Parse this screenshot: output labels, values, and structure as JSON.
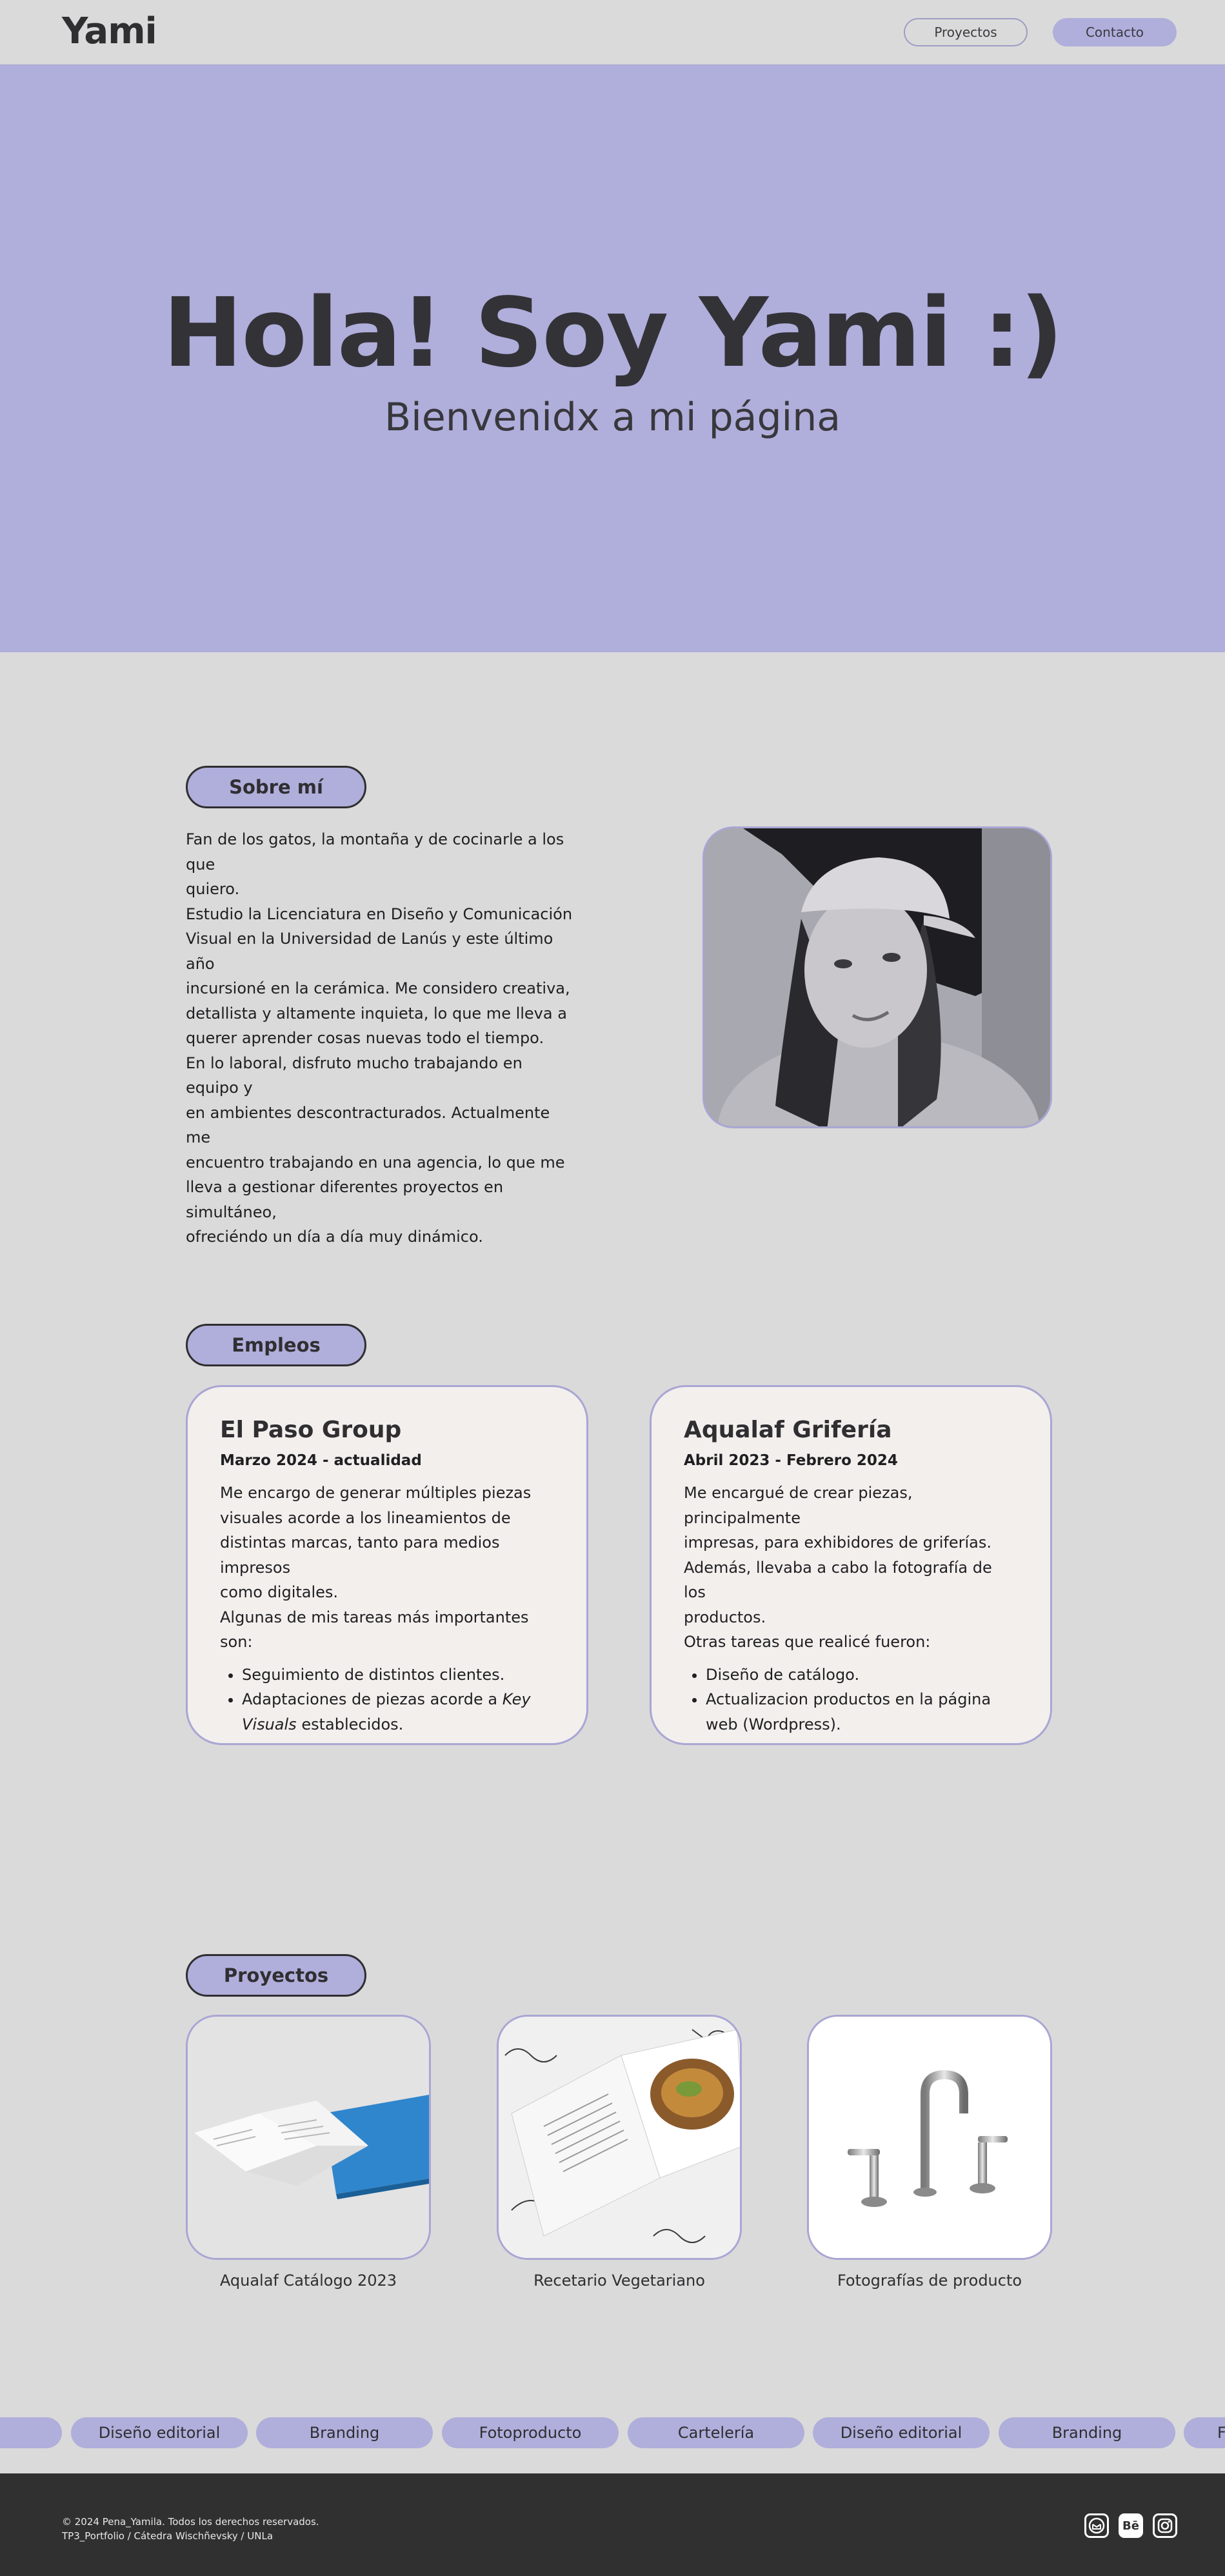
{
  "header": {
    "logo": "Yami",
    "nav": {
      "projects": "Proyectos",
      "contact": "Contacto"
    }
  },
  "hero": {
    "title": "Hola! Soy Yami :)",
    "subtitle": "Bienvenidx a mi página"
  },
  "about": {
    "heading": "Sobre mí",
    "lines": [
      "Fan de los gatos, la montaña y de cocinarle a los que",
      "quiero.",
      "Estudio la Licenciatura en Diseño y Comunicación",
      "Visual en la Universidad de Lanús y este último año",
      "incursioné en la cerámica. Me considero creativa,",
      "detallista y altamente inquieta, lo que me lleva a",
      "querer aprender cosas nuevas todo el tiempo.",
      "En lo laboral, disfruto mucho trabajando en equipo y",
      "en ambientes descontracturados. Actualmente me",
      "encuentro trabajando en una agencia, lo que me",
      "lleva a gestionar diferentes proyectos en simultáneo,",
      "ofreciéndo un día a día muy dinámico."
    ]
  },
  "jobs": {
    "heading": "Empleos",
    "items": [
      {
        "title": "El Paso Group",
        "date": "Marzo 2024 - actualidad",
        "desc_lines": [
          "Me encargo de generar múltiples piezas",
          "visuales acorde a los lineamientos de",
          "distintas marcas, tanto para medios impresos",
          "como digitales.",
          "Algunas de mis tareas más importantes son:"
        ],
        "bullets": [
          "Seguimiento de distintos clientes."
        ],
        "bullet2_pre": "Adaptaciones de piezas acorde a ",
        "bullet2_em": "Key Visuals",
        "bullet2_post": " establecidos."
      },
      {
        "title": "Aqualaf Grifería",
        "date": "Abril 2023 - Febrero 2024",
        "desc_lines": [
          "Me encargué de crear piezas, principalmente",
          "impresas, para exhibidores de griferías.",
          "Además, llevaba a cabo la fotografía de los",
          "productos.",
          "Otras tareas que realicé fueron:"
        ],
        "bullets": [
          "Diseño de catálogo.",
          "Actualizacion productos en la página web (Wordpress)."
        ]
      }
    ]
  },
  "projects": {
    "heading": "Proyectos",
    "items": [
      {
        "label": "Aqualaf Catálogo 2023"
      },
      {
        "label": "Recetario Vegetariano"
      },
      {
        "label": "Fotografías de producto"
      }
    ]
  },
  "marquee": {
    "tags": [
      "a",
      "Diseño editorial",
      "Branding",
      "Fotoproducto",
      "Cartelería",
      "Diseño editorial",
      "Branding",
      "F"
    ]
  },
  "footer": {
    "copyright": "© 2024 Pena_Yamila. Todos los derechos reservados.",
    "credit": "TP3_Portfolio / Cátedra Wischñevsky / UNLa",
    "social": [
      "mail-icon",
      "behance-icon",
      "instagram-icon"
    ],
    "behance_text": "Bē"
  },
  "colors": {
    "lavender": "#b0aedb",
    "background": "#dadada",
    "card": "#f2efed",
    "dark": "#313031"
  }
}
